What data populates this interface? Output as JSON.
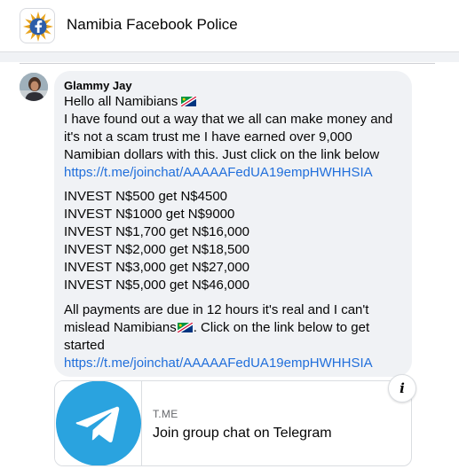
{
  "header": {
    "group_name": "Namibia Facebook Police",
    "group_icon": "facebook-badge-icon"
  },
  "comment": {
    "author": "Glammy Jay",
    "greeting": "Hello all Namibians",
    "paragraph1": [
      "I have found out a way that we all can make money and",
      "it's not a scam trust me I have earned over 9,000",
      "Namibian dollars with this. Just click on the link below"
    ],
    "link": "https://t.me/joinchat/AAAAAFedUA19empHWHHSIA",
    "invest_lines": [
      "INVEST N$500 get N$4500",
      "INVEST N$1000 get N$9000",
      "INVEST N$1,700 get N$16,000",
      "INVEST N$2,000 get N$18,500",
      "INVEST N$3,000 get N$27,000",
      "INVEST N$5,000 get N$46,000"
    ],
    "paragraph2_line1": "All payments are due in 12 hours it's real and I can't",
    "paragraph2_line2_a": "mislead Namibians",
    "paragraph2_line2_b": ". Click on the link below to get",
    "paragraph2_line3": "started",
    "link2": "https://t.me/joinchat/AAAAAFedUA19empHWHHSIA",
    "flag_icon": "namibia-flag-icon"
  },
  "link_preview": {
    "domain": "T.ME",
    "title": "Join group chat on Telegram",
    "thumbnail_icon": "telegram-icon",
    "info_label": "i"
  },
  "colors": {
    "link": "#216fdb",
    "telegram": "#2aa3df",
    "bubble": "#f0f2f5"
  }
}
